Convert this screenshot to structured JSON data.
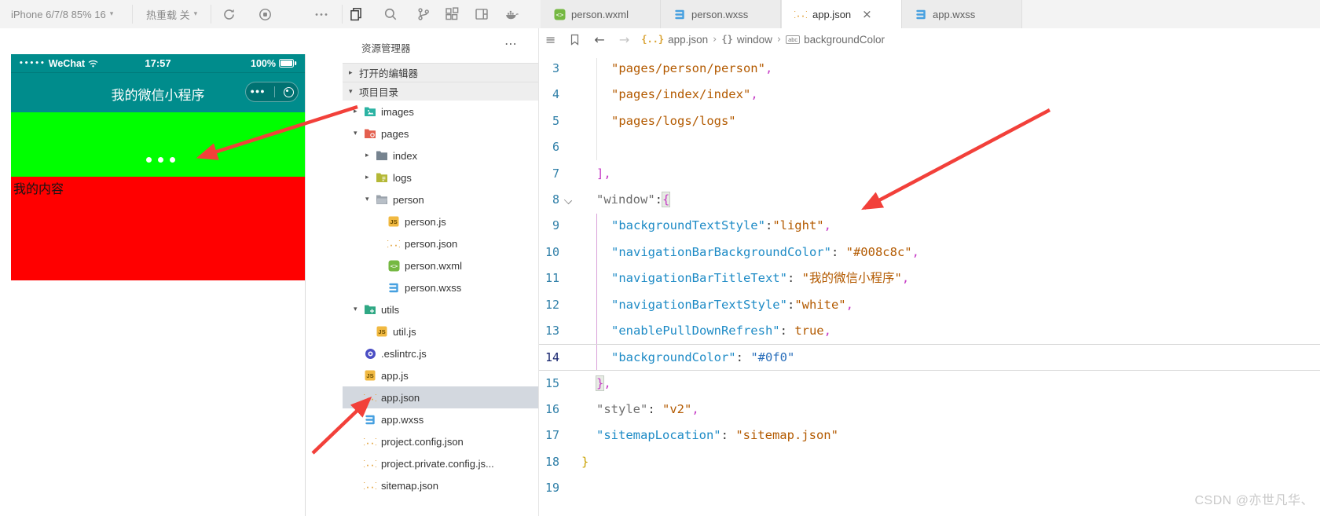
{
  "toolbar": {
    "device_label": "iPhone 6/7/8 85% 16",
    "hot_reload_label": "热重载 关",
    "icons": [
      "refresh",
      "stop",
      "more",
      "files",
      "search",
      "source-control",
      "extensions",
      "editor-layout",
      "docker"
    ]
  },
  "tabs": [
    {
      "label": "person.wxml",
      "icon": "wxml",
      "active": false
    },
    {
      "label": "person.wxss",
      "icon": "wxss",
      "active": false
    },
    {
      "label": "app.json",
      "icon": "json",
      "active": true,
      "closable": true
    },
    {
      "label": "app.wxss",
      "icon": "wxss",
      "active": false
    }
  ],
  "breadcrumb": {
    "file": "app.json",
    "symbol": "window",
    "property": "backgroundColor"
  },
  "simulator": {
    "carrier": "WeChat",
    "time": "17:57",
    "battery": "100%",
    "nav_title": "我的微信小程序",
    "content_text": "我的内容",
    "colors": {
      "nav_bar": "#008c8c",
      "pulldown": "#00ff00",
      "content": "#ff0000"
    }
  },
  "explorer": {
    "title": "资源管理器",
    "sections": [
      {
        "label": "打开的编辑器",
        "expanded": false
      },
      {
        "label": "项目目录",
        "expanded": true
      }
    ],
    "tree": [
      {
        "label": "images",
        "icon": "folder-images",
        "level": 1,
        "arrow": "collapsed"
      },
      {
        "label": "pages",
        "icon": "folder-pages",
        "level": 1,
        "arrow": "expanded"
      },
      {
        "label": "index",
        "icon": "folder-plain",
        "level": 2,
        "arrow": "collapsed"
      },
      {
        "label": "logs",
        "icon": "folder-logs",
        "level": 2,
        "arrow": "collapsed"
      },
      {
        "label": "person",
        "icon": "folder-open",
        "level": 2,
        "arrow": "expanded"
      },
      {
        "label": "person.js",
        "icon": "js",
        "level": 3
      },
      {
        "label": "person.json",
        "icon": "json",
        "level": 3
      },
      {
        "label": "person.wxml",
        "icon": "wxml",
        "level": 3
      },
      {
        "label": "person.wxss",
        "icon": "wxss",
        "level": 3
      },
      {
        "label": "utils",
        "icon": "folder-utils",
        "level": 1,
        "arrow": "expanded"
      },
      {
        "label": "util.js",
        "icon": "js",
        "level": 2
      },
      {
        "label": ".eslintrc.js",
        "icon": "eslint",
        "level": 1
      },
      {
        "label": "app.js",
        "icon": "js",
        "level": 1
      },
      {
        "label": "app.json",
        "icon": "json",
        "level": 1,
        "selected": true
      },
      {
        "label": "app.wxss",
        "icon": "wxss",
        "level": 1
      },
      {
        "label": "project.config.json",
        "icon": "json",
        "level": 1
      },
      {
        "label": "project.private.config.js...",
        "icon": "json",
        "level": 1
      },
      {
        "label": "sitemap.json",
        "icon": "json",
        "level": 1
      }
    ]
  },
  "editor": {
    "lines": [
      {
        "n": "3",
        "ind": 2,
        "tokens": [
          {
            "t": "\"pages/person/person\"",
            "c": "str"
          },
          {
            "t": ",",
            "c": "pct"
          }
        ]
      },
      {
        "n": "4",
        "ind": 2,
        "tokens": [
          {
            "t": "\"pages/index/index\"",
            "c": "str"
          },
          {
            "t": ",",
            "c": "pct"
          }
        ]
      },
      {
        "n": "5",
        "ind": 2,
        "tokens": [
          {
            "t": "\"pages/logs/logs\"",
            "c": "str"
          }
        ]
      },
      {
        "n": "6",
        "ind": 2,
        "tokens": []
      },
      {
        "n": "7",
        "ind": 1,
        "tokens": [
          {
            "t": "],",
            "c": "pct"
          }
        ]
      },
      {
        "n": "8",
        "ind": 1,
        "fold": true,
        "tokens": [
          {
            "t": "\"window\"",
            "c": "gkey"
          },
          {
            "t": ":",
            "c": "col"
          },
          {
            "t": "{",
            "c": "pct",
            "box": true
          }
        ]
      },
      {
        "n": "9",
        "ind": 2,
        "tokens": [
          {
            "t": "\"backgroundTextStyle\"",
            "c": "key"
          },
          {
            "t": ":",
            "c": "col"
          },
          {
            "t": "\"light\"",
            "c": "str"
          },
          {
            "t": ",",
            "c": "pct"
          }
        ]
      },
      {
        "n": "10",
        "ind": 2,
        "tokens": [
          {
            "t": "\"navigationBarBackgroundColor\"",
            "c": "key"
          },
          {
            "t": ": ",
            "c": "col"
          },
          {
            "t": "\"#008c8c\"",
            "c": "str"
          },
          {
            "t": ",",
            "c": "pct"
          }
        ]
      },
      {
        "n": "11",
        "ind": 2,
        "tokens": [
          {
            "t": "\"navigationBarTitleText\"",
            "c": "key"
          },
          {
            "t": ": ",
            "c": "col"
          },
          {
            "t": "\"我的微信小程序\"",
            "c": "str"
          },
          {
            "t": ",",
            "c": "pct"
          }
        ]
      },
      {
        "n": "12",
        "ind": 2,
        "tokens": [
          {
            "t": "\"navigationBarTextStyle\"",
            "c": "key"
          },
          {
            "t": ":",
            "c": "col"
          },
          {
            "t": "\"white\"",
            "c": "str"
          },
          {
            "t": ",",
            "c": "pct"
          }
        ]
      },
      {
        "n": "13",
        "ind": 2,
        "tokens": [
          {
            "t": "\"enablePullDownRefresh\"",
            "c": "key"
          },
          {
            "t": ": ",
            "c": "col"
          },
          {
            "t": "true",
            "c": "bool"
          },
          {
            "t": ",",
            "c": "pct"
          }
        ]
      },
      {
        "n": "14",
        "ind": 2,
        "cur": true,
        "tokens": [
          {
            "t": "\"backgroundColor\"",
            "c": "key"
          },
          {
            "t": ": ",
            "c": "col"
          },
          {
            "t": "\"#0f0\"",
            "c": "blu"
          }
        ]
      },
      {
        "n": "15",
        "ind": 1,
        "tokens": [
          {
            "t": "}",
            "c": "pct",
            "box": true
          },
          {
            "t": ",",
            "c": "pct"
          }
        ]
      },
      {
        "n": "16",
        "ind": 1,
        "tokens": [
          {
            "t": "\"style\"",
            "c": "gkey"
          },
          {
            "t": ": ",
            "c": "col"
          },
          {
            "t": "\"v2\"",
            "c": "str"
          },
          {
            "t": ",",
            "c": "pct"
          }
        ]
      },
      {
        "n": "17",
        "ind": 1,
        "tokens": [
          {
            "t": "\"sitemapLocation\"",
            "c": "key"
          },
          {
            "t": ": ",
            "c": "col"
          },
          {
            "t": "\"sitemap.json\"",
            "c": "str"
          }
        ]
      },
      {
        "n": "18",
        "ind": 0,
        "tokens": [
          {
            "t": "}",
            "c": "gold"
          }
        ]
      },
      {
        "n": "19",
        "ind": 0,
        "tokens": []
      }
    ]
  },
  "annotation_color": "#f2403a",
  "watermark": "CSDN @亦世凡华、"
}
